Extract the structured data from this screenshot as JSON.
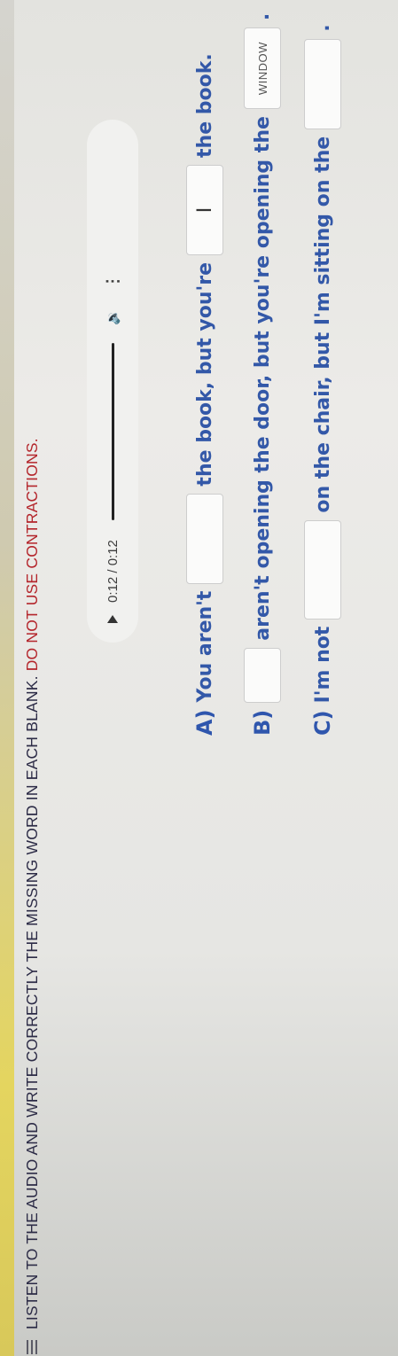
{
  "header": {
    "menu_icon": "hamburger-icon",
    "instruction": "LISTEN TO THE AUDIO AND WRITE CORRECTLY THE MISSING WORD IN EACH BLANK.",
    "warning": "DO NOT USE CONTRACTIONS."
  },
  "audio": {
    "time": "0:12 / 0:12",
    "play_icon": "play-icon",
    "volume_icon": "volume-icon",
    "more_icon": "more-vert-icon",
    "progress": 1.0
  },
  "questions": [
    {
      "label": "A)",
      "part1": "You aren't",
      "blank1": "",
      "part2": "the book, but you're",
      "blank2": "",
      "part3": "the book."
    },
    {
      "label": "B)",
      "blank1": "",
      "part1": "aren't opening the door, but you're opening the",
      "blank2": "WINDOW",
      "end": "."
    },
    {
      "label": "C)",
      "part1": "I'm not",
      "blank1": "",
      "part2": "on the chair, but I'm sitting on the",
      "blank2": "",
      "end": "."
    }
  ]
}
